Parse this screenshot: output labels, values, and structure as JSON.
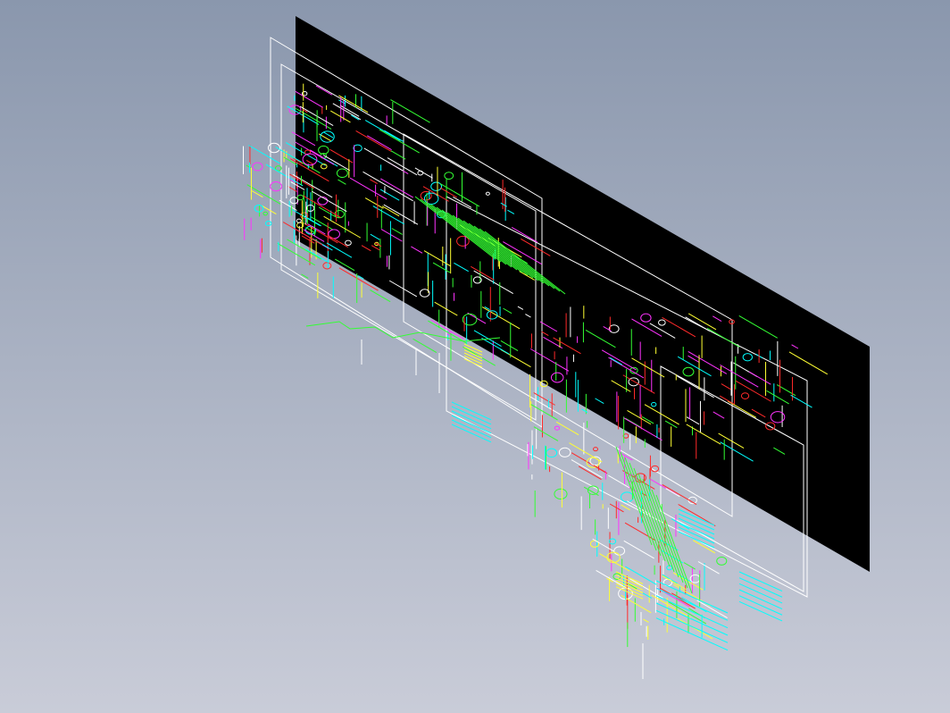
{
  "viewport": {
    "background_top": "#8a97ad",
    "background_bottom": "#c9ccd8"
  },
  "colors": {
    "sheet": "#000000",
    "frame": "#ffffff",
    "green": "#33ff33",
    "cyan": "#00ffff",
    "magenta": "#ff33ff",
    "yellow": "#ffff33",
    "red": "#ff2a2a",
    "white": "#ffffff"
  },
  "drawing": {
    "description_visible_text": "",
    "sheets_count": 1,
    "frames_count": 3
  }
}
